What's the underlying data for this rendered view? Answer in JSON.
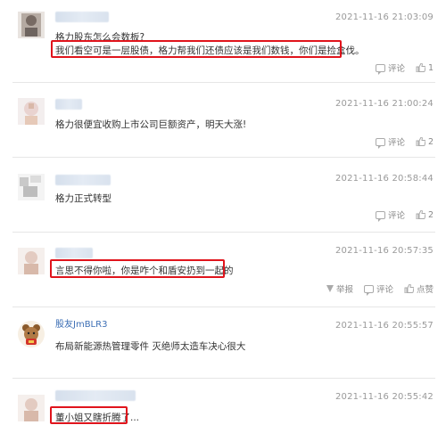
{
  "comments": [
    {
      "username": "",
      "timestamp": "2021-11-16 21:03:09",
      "text": "格力股东怎么会数板?",
      "text2": "我们看空可是一层股债，格力帮我们还债应该是我们数钱，你们是捡盒伐。",
      "reply_label": "评论",
      "like_count": "1"
    },
    {
      "username": "",
      "timestamp": "2021-11-16 21:00:24",
      "text": "格力很便宜收购上市公司巨额资产，明天大涨!",
      "reply_label": "评论",
      "like_count": "2"
    },
    {
      "username": "",
      "timestamp": "2021-11-16 20:58:44",
      "text": "格力正式转型",
      "reply_label": "评论",
      "like_count": "2"
    },
    {
      "username": "",
      "timestamp": "2021-11-16 20:57:35",
      "text": "言思不得你啦，你是咋个和盾安扔到一起的",
      "report_label": "举报",
      "reply_label": "评论",
      "like_label": "点赞"
    },
    {
      "username": "股友JmBLR3",
      "timestamp": "2021-11-16 20:55:57",
      "text": "布局新能源热管理零件 灭绝师太造车决心很大"
    },
    {
      "username": "",
      "timestamp": "2021-11-16 20:55:42",
      "text": "董小姐又瞎折腾了",
      "text_suffix": "..."
    }
  ]
}
